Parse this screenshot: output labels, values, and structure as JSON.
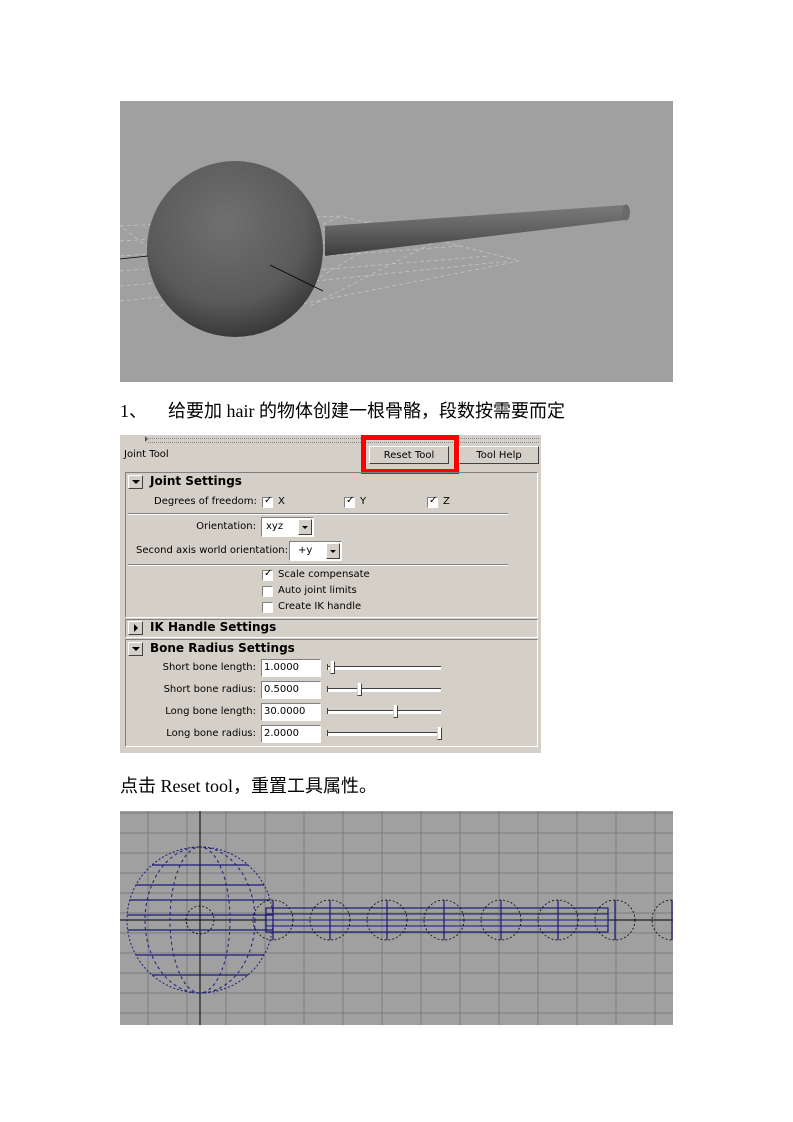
{
  "figure1": {
    "alt": "Sphere with attached cylinder in Maya perspective viewport"
  },
  "captions": {
    "step1_number": "1、",
    "step1_text": "给要加 hair 的物体创建一根骨骼，段数按需要而定",
    "step2_text": "点击 Reset tool，重置工具属性。"
  },
  "panel": {
    "tool_title": "Joint Tool",
    "reset_button": "Reset Tool",
    "help_button": "Tool Help",
    "highlight_color": "#ff0000",
    "joint_settings": {
      "title": "Joint Settings",
      "expanded": true,
      "dof_label": "Degrees of freedom:",
      "dof": [
        {
          "label": "X",
          "checked": true
        },
        {
          "label": "Y",
          "checked": true
        },
        {
          "label": "Z",
          "checked": true
        }
      ],
      "orientation_label": "Orientation:",
      "orientation_value": "xyz",
      "second_axis_label": "Second axis world orientation:",
      "second_axis_value": "+y",
      "options": [
        {
          "label": "Scale compensate",
          "checked": true
        },
        {
          "label": "Auto joint limits",
          "checked": false
        },
        {
          "label": "Create IK handle",
          "checked": false
        }
      ]
    },
    "ik_handle_settings": {
      "title": "IK Handle Settings",
      "expanded": false
    },
    "bone_radius_settings": {
      "title": "Bone Radius Settings",
      "expanded": true,
      "rows": [
        {
          "label": "Short bone length:",
          "value": "1.0000",
          "slider_fraction": 0.03
        },
        {
          "label": "Short bone radius:",
          "value": "0.5000",
          "slider_fraction": 0.27
        },
        {
          "label": "Long bone length:",
          "value": "30.0000",
          "slider_fraction": 0.6
        },
        {
          "label": "Long bone radius:",
          "value": "2.0000",
          "slider_fraction": 1.0
        }
      ]
    }
  },
  "figure3": {
    "alt": "Wireframe sphere and cylinder with joint chain in Maya orthographic view",
    "wire_color": "#1a1a7a"
  }
}
